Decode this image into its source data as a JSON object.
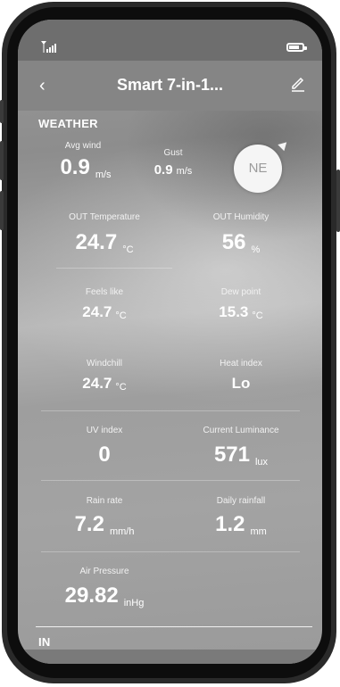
{
  "app": {
    "title": "Smart 7-in-1..."
  },
  "status_bar": {
    "signal_icon": "signal-icon",
    "battery_icon": "battery-icon"
  },
  "icons": {
    "back": "back-arrow-icon",
    "edit": "edit-pencil-icon"
  },
  "weather": {
    "heading": "WEATHER",
    "avg_wind": {
      "label": "Avg wind",
      "value": "0.9",
      "unit": "m/s"
    },
    "gust": {
      "label": "Gust",
      "value": "0.9",
      "unit": "m/s"
    },
    "wind_direction": "NE",
    "out_temperature": {
      "label": "OUT Temperature",
      "value": "24.7",
      "unit": "°C"
    },
    "out_humidity": {
      "label": "OUT Humidity",
      "value": "56",
      "unit": "%"
    },
    "feels_like": {
      "label": "Feels like",
      "value": "24.7",
      "unit": "°C"
    },
    "dew_point": {
      "label": "Dew point",
      "value": "15.3",
      "unit": "°C"
    },
    "windchill": {
      "label": "Windchill",
      "value": "24.7",
      "unit": "°C"
    },
    "heat_index": {
      "label": "Heat index",
      "value": "Lo"
    },
    "uv_index": {
      "label": "UV index",
      "value": "0"
    },
    "current_luminance": {
      "label": "Current Luminance",
      "value": "571",
      "unit": "lux"
    },
    "rain_rate": {
      "label": "Rain rate",
      "value": "7.2",
      "unit": "mm/h"
    },
    "daily_rainfall": {
      "label": "Daily rainfall",
      "value": "1.2",
      "unit": "mm"
    },
    "air_pressure": {
      "label": "Air Pressure",
      "value": "29.82",
      "unit": "inHg"
    }
  },
  "indoor": {
    "heading": "IN"
  },
  "colors": {
    "statusbar": "#6e6e6e",
    "appbar": "#858585",
    "text": "#ffffff"
  }
}
